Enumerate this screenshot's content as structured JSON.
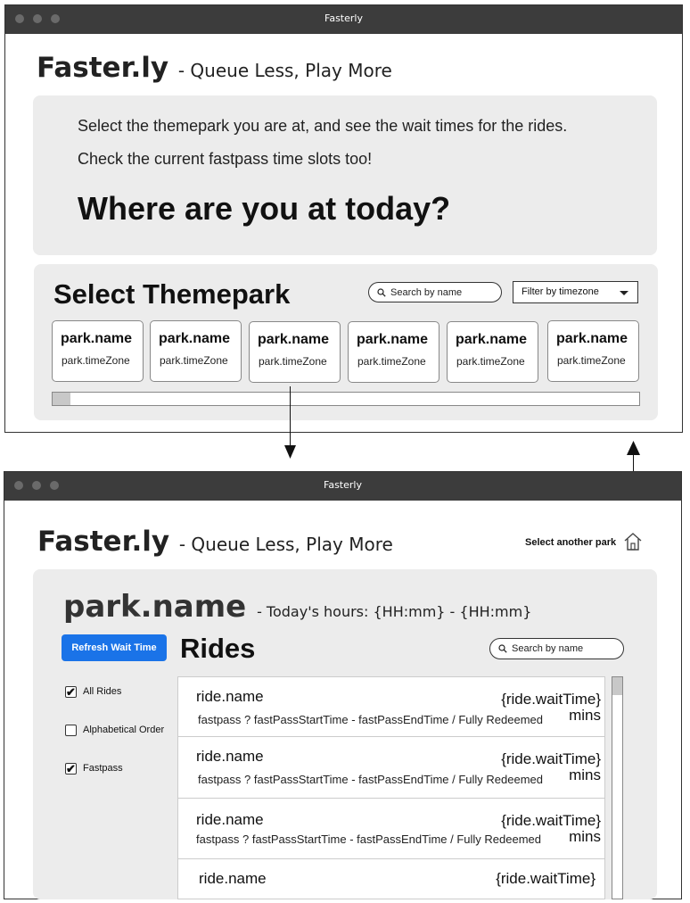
{
  "window1": {
    "title": "Fasterly",
    "logo": "Faster.ly",
    "tagline": "- Queue Less, Play More",
    "intro": {
      "line1": "Select the themepark you are at, and see the wait times for the rides.",
      "line2": "Check the current fastpass time slots too!",
      "heading": "Where are you at today?"
    },
    "select_section": {
      "title": "Select Themepark",
      "search_placeholder": "Search by name",
      "filter_label": "Filter by timezone",
      "parks": [
        {
          "name": "park.name",
          "timezone": "park.timeZone"
        },
        {
          "name": "park.name",
          "timezone": "park.timeZone"
        },
        {
          "name": "park.name",
          "timezone": "park.timeZone"
        },
        {
          "name": "park.name",
          "timezone": "park.timeZone"
        },
        {
          "name": "park.name",
          "timezone": "park.timeZone"
        },
        {
          "name": "park.name",
          "timezone": "park.timeZone"
        }
      ]
    }
  },
  "window2": {
    "title": "Fasterly",
    "logo": "Faster.ly",
    "tagline": "- Queue Less, Play More",
    "select_another": "Select another park",
    "park_title": "park.name",
    "hours": "- Today's hours: {HH:mm} - {HH:mm}",
    "refresh_label": "Refresh Wait Time",
    "rides_title": "Rides",
    "search_placeholder": "Search by name",
    "filters": [
      {
        "label": "All Rides",
        "checked": true,
        "mark": "✔"
      },
      {
        "label": "Alphabetical Order",
        "checked": false,
        "mark": ""
      },
      {
        "label": "Fastpass",
        "checked": true,
        "mark": "✔"
      }
    ],
    "rides": [
      {
        "name": "ride.name",
        "wait": "{ride.waitTime}",
        "mins": "mins",
        "fastpass": "fastpass ? fastPassStartTime - fastPassEndTime / Fully Redeemed"
      },
      {
        "name": "ride.name",
        "wait": "{ride.waitTime}",
        "mins": "mins",
        "fastpass": "fastpass ? fastPassStartTime - fastPassEndTime / Fully Redeemed"
      },
      {
        "name": "ride.name",
        "wait": "{ride.waitTime}",
        "mins": "mins",
        "fastpass": "fastpass ? fastPassStartTime - fastPassEndTime / Fully Redeemed"
      },
      {
        "name": "ride.name",
        "wait": "{ride.waitTime}"
      }
    ]
  }
}
